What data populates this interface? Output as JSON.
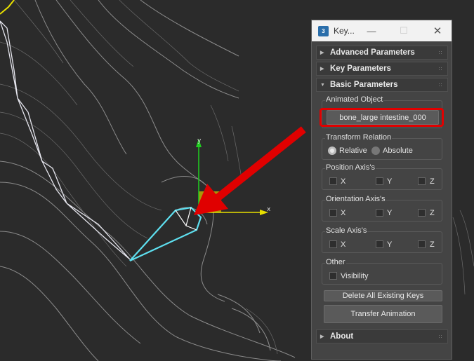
{
  "window": {
    "title": "Key...",
    "app_icon_text": "3",
    "minimize_glyph": "—",
    "maximize_glyph": "☐",
    "close_glyph": "✕"
  },
  "rollouts": {
    "advanced": "Advanced Parameters",
    "key": "Key Parameters",
    "basic": "Basic Parameters",
    "about": "About"
  },
  "animated_object": {
    "title": "Animated Object",
    "value": "bone_large intestine_000"
  },
  "transform_relation": {
    "title": "Transform Relation",
    "relative": "Relative",
    "absolute": "Absolute",
    "selected": "Relative"
  },
  "position_axis": {
    "title": "Position Axis's",
    "x": "X",
    "y": "Y",
    "z": "Z"
  },
  "orientation_axis": {
    "title": "Orientation Axis's",
    "x": "X",
    "y": "Y",
    "z": "Z"
  },
  "scale_axis": {
    "title": "Scale Axis's",
    "x": "X",
    "y": "Y",
    "z": "Z"
  },
  "other": {
    "title": "Other",
    "visibility": "Visibility"
  },
  "buttons": {
    "delete_keys": "Delete All Existing Keys",
    "transfer": "Transfer Animation"
  },
  "viewport": {
    "gizmo_x_label": "x",
    "gizmo_y_label": "y"
  },
  "colors": {
    "highlight": "#e00000",
    "selected_bone": "#5ee0f0",
    "gizmo_x": "#e8e000",
    "gizmo_y": "#20d020",
    "gizmo_plane": "#c8b400"
  }
}
